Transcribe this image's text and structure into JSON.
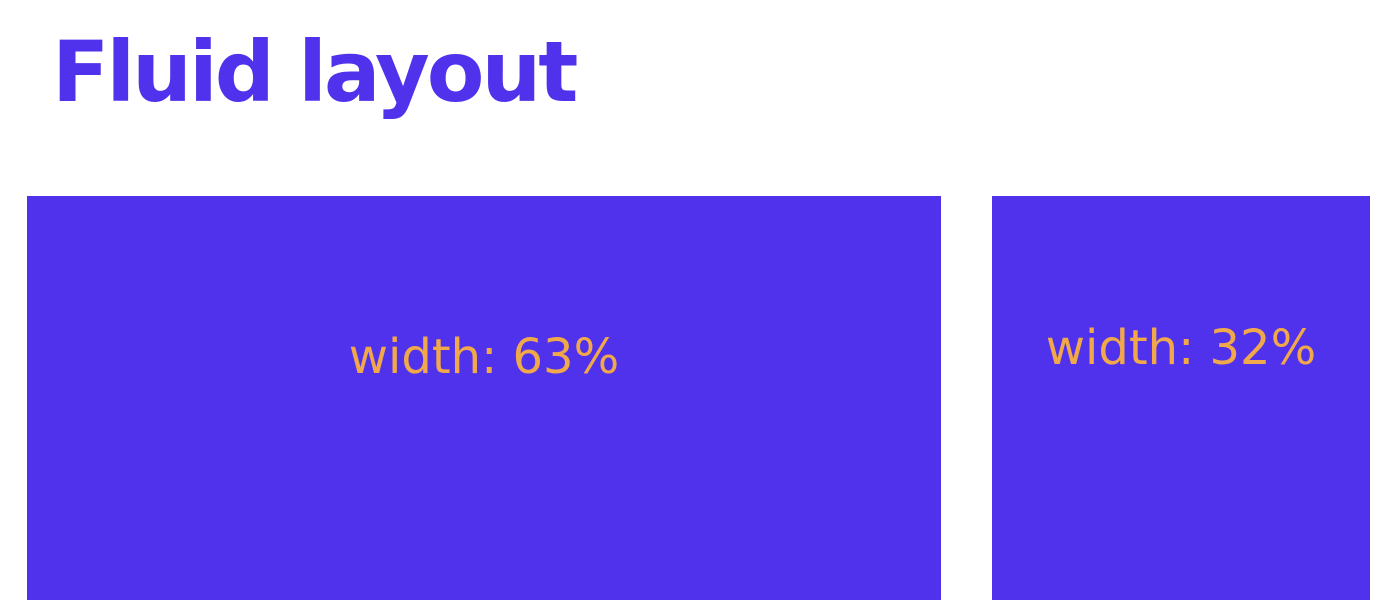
{
  "title": "Fluid layout",
  "colors": {
    "title": "#5132ec",
    "box_fill": "#5132ec",
    "label": "#f0a84a",
    "background": "#ffffff"
  },
  "boxes": [
    {
      "label": "width: 63%",
      "width_percent": 63
    },
    {
      "label": "width: 32%",
      "width_percent": 32
    }
  ]
}
